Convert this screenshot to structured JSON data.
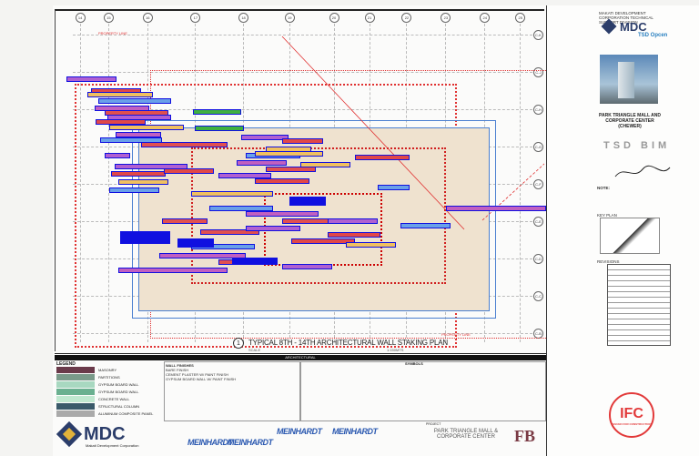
{
  "drawing": {
    "grid_columns": [
      "14",
      "15",
      "16",
      "17",
      "18",
      "19",
      "20",
      "21",
      "22",
      "23",
      "24",
      "25"
    ],
    "grid_rows": [
      "C-K",
      "C-J",
      "C-H",
      "C-G",
      "C-F",
      "C-E",
      "C-D",
      "C-C",
      "C-B"
    ],
    "property_line_label": "PROPERTY LINE",
    "plan_number": "1",
    "plan_title": "TYPICAL 8TH - 14TH ARCHITECTURAL WALL STAKING PLAN",
    "plan_scale_label": "SCALE",
    "plan_scale": "1:150MTS"
  },
  "title_block": {
    "company_header": "MAKATI DEVELOPMENT CORPORATION TECHNICAL SUPPORT DIVISION",
    "logo_text": "MDC",
    "division": "TSD Opcen",
    "project_name": "PARK TRIANGLE MALL AND CORPORATE CENTER (CHEWER)",
    "bim_label": "TSD BIM",
    "note_label": "NOTE:",
    "key_plan_label": "KEY PLAN",
    "revisions_label": "REVISIONS",
    "ifc_stamp": "IFC",
    "ifc_sub": "ISSUED FOR CONSTRUCTION",
    "sheet_title": "TYPICAL 8TH - 14TH ARCHITECTURAL WALL STAKING PLAN",
    "scale": "1:150",
    "sheet_no_label": "SHEET NO."
  },
  "legend": {
    "architectural_header": "ARCHITECTURAL",
    "symbols_header": "SYMBOLS",
    "legend_label": "LEGEND",
    "wall_types": [
      "MASONRY",
      "PARTITIONS",
      "GYPSUM BOARD WALL",
      "GYPSUM BOARD WALL",
      "CONCRETE WALL",
      "STRUCTURAL COLUMN",
      "ALUMINUM COMPOSITE PANEL"
    ],
    "wall_finishes": [
      "BARE FINISH",
      "CEMENT PLASTER W/ PAINT FINISH",
      "GYPSUM BOARD WALL W/ PAINT FINISH"
    ],
    "wall_finishes_header": "WALL FINISHES",
    "project_label": "PROJECT",
    "project_name": "PARK TRIANGLE MALL & CORPORATE CENTER",
    "mdc_logo": "MDC",
    "mdc_full": "Makati Development Corporation",
    "consultants": [
      "MEINHARDT",
      "MEINHARDT",
      "MEINHARDT",
      "MEINHARDT"
    ],
    "owner_logo": "FB"
  },
  "colors": {
    "annotation_border": "#1010e0",
    "property_line": "#e03030",
    "stamp": "#e23a3a"
  }
}
